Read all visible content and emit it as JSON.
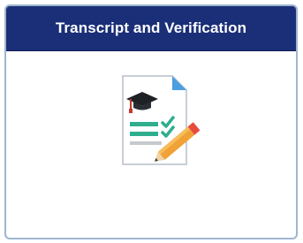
{
  "tile": {
    "title": "Transcript and Verification",
    "icon": "transcript-document-pencil-icon"
  },
  "colors": {
    "header_bg": "#1b2f78",
    "border": "#9fb6cf",
    "check_green": "#2fae8e",
    "pencil_orange": "#f0a236"
  }
}
